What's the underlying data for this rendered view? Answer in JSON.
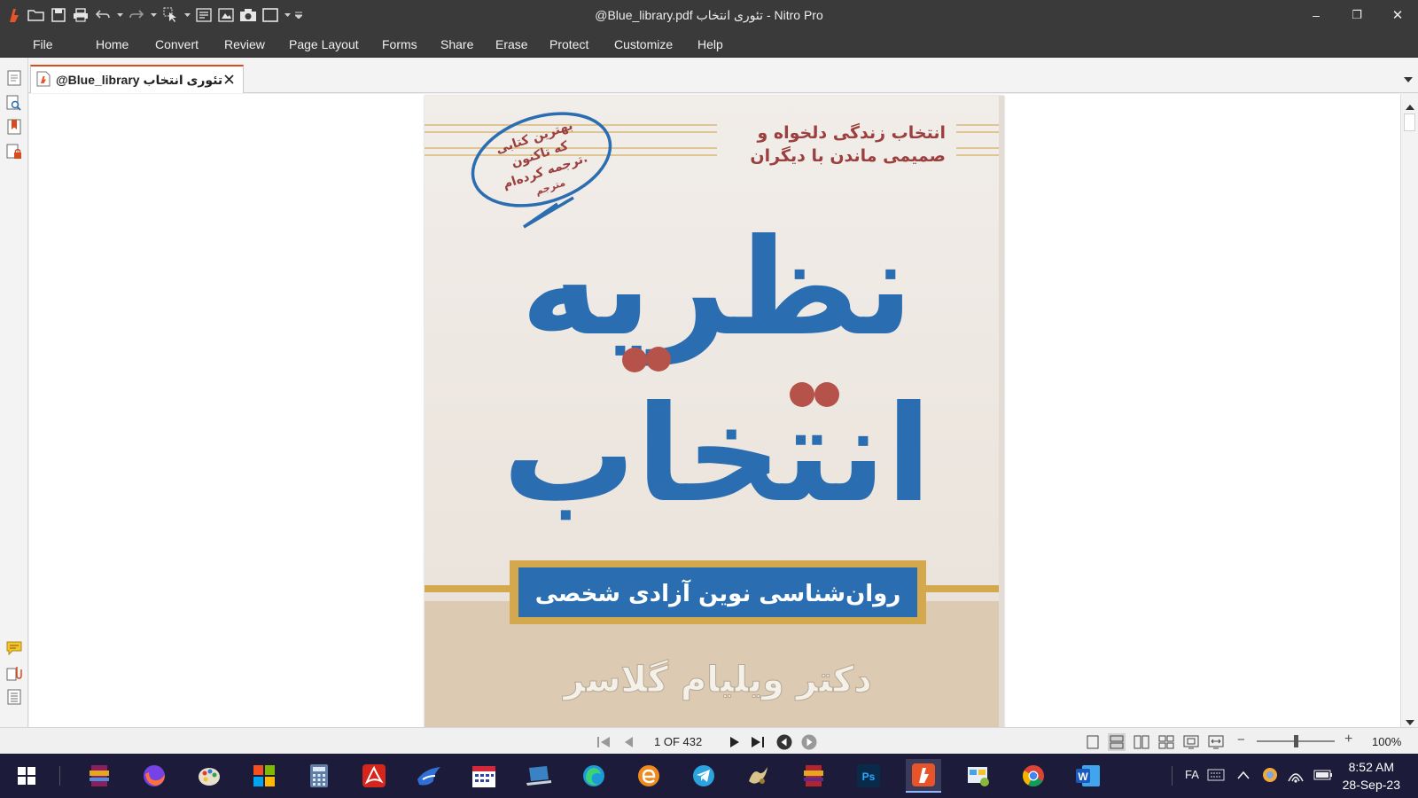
{
  "window": {
    "title": "@Blue_library.pdf تئوری انتخاب - Nitro Pro",
    "minimize": "–",
    "restore": "❐",
    "close": "✕"
  },
  "colors": {
    "accent": "#d94a1e",
    "chrome": "#3a3a3a",
    "taskbar": "#1c1c3a",
    "cover_blue": "#2a6db0",
    "cover_red": "#b5524a",
    "cover_gold": "#d4a84c"
  },
  "ribbon": {
    "tabs": [
      "File",
      "Home",
      "Convert",
      "Review",
      "Page Layout",
      "Forms",
      "Share",
      "Erase",
      "Protect",
      "Customize",
      "Help"
    ]
  },
  "document_tab": {
    "label": "@Blue_library تئوری انتخاب",
    "icon": "pdf-file-icon"
  },
  "cover": {
    "tagline_line1": "انتخاب زندگی دلخواه و",
    "tagline_line2": "صمیمی ماندن با دیگران",
    "bubble_line1": "بهترین کتابی",
    "bubble_line2": "که تاکنون",
    "bubble_line3": "ترجمه کرده‌ام.",
    "bubble_line4": "مترجم",
    "title_line1": "نظریه",
    "title_line2": "انتخاب",
    "subtitle": "روان‌شناسی نوین آزادی شخصی",
    "author": "دکتر ویلیام گلاسر"
  },
  "statusbar": {
    "page_counter": "1 OF 432",
    "zoom": "100%",
    "zoom_minus": "−",
    "zoom_plus": "+"
  },
  "taskbar": {
    "language": "FA",
    "time": "8:52 AM",
    "date": "28-Sep-23"
  }
}
